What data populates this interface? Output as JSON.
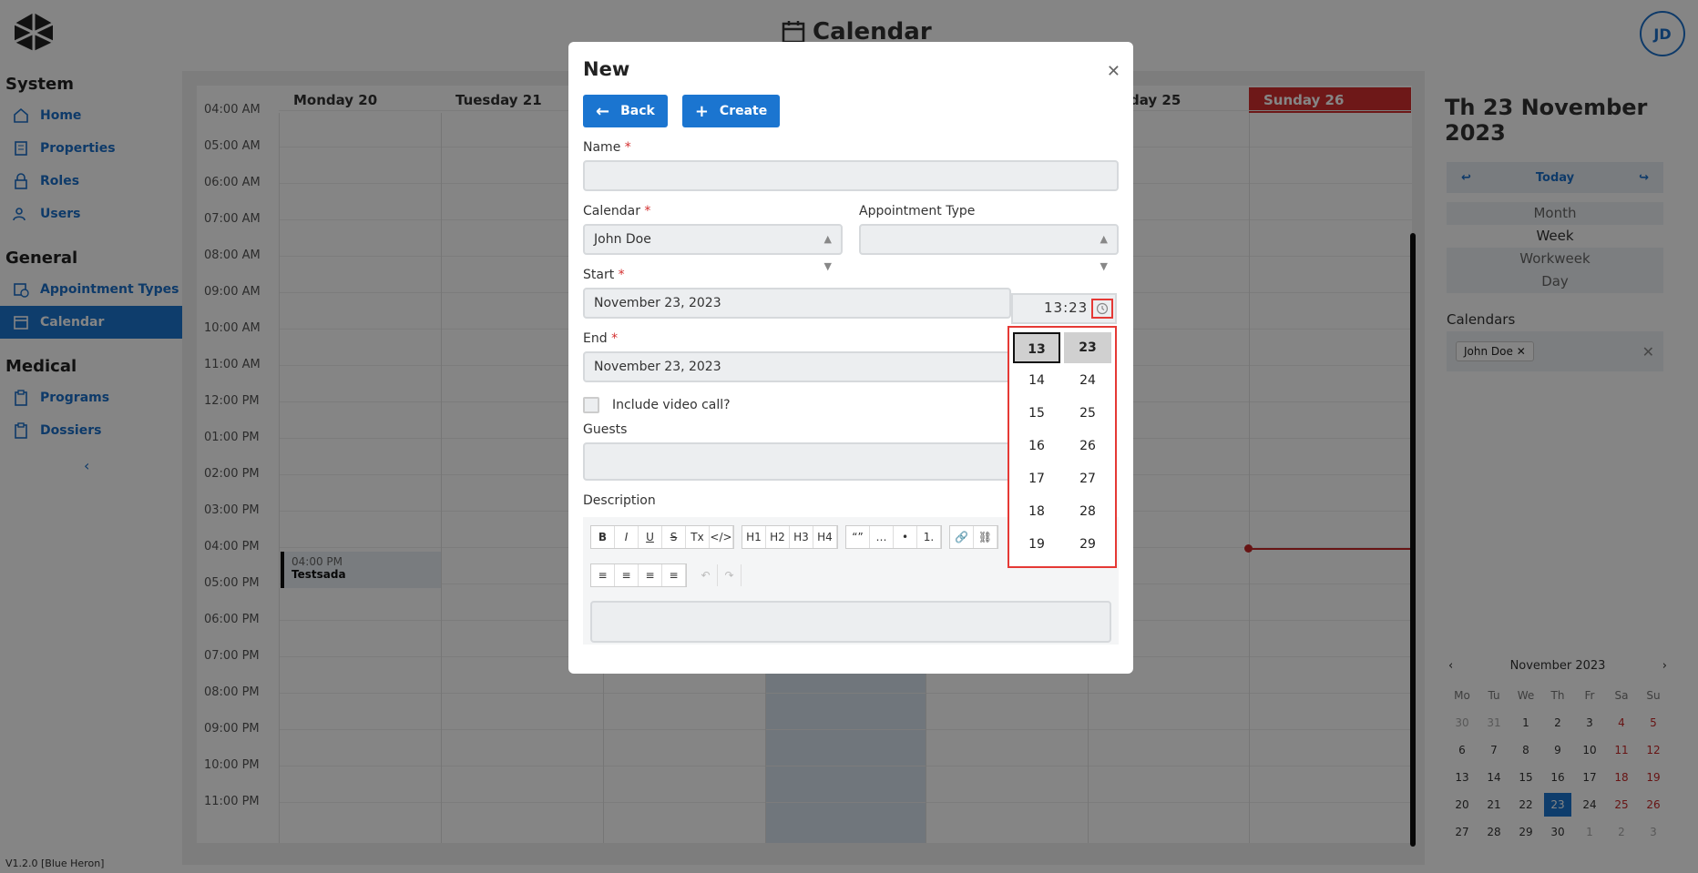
{
  "app": {
    "title": "Calendar",
    "avatar_initials": "JD",
    "version": "V1.2.0 [Blue Heron]"
  },
  "sidebar": {
    "sections": [
      {
        "title": "System",
        "items": [
          {
            "label": "Home",
            "icon": "home-icon"
          },
          {
            "label": "Properties",
            "icon": "building-icon"
          },
          {
            "label": "Roles",
            "icon": "lock-icon"
          },
          {
            "label": "Users",
            "icon": "users-icon"
          }
        ]
      },
      {
        "title": "General",
        "items": [
          {
            "label": "Appointment Types",
            "icon": "calendar-clock-icon"
          },
          {
            "label": "Calendar",
            "icon": "calendar-icon",
            "active": true
          }
        ]
      },
      {
        "title": "Medical",
        "items": [
          {
            "label": "Programs",
            "icon": "clipboard-icon"
          },
          {
            "label": "Dossiers",
            "icon": "clipboard-icon"
          }
        ]
      }
    ]
  },
  "calendar": {
    "days": [
      "Monday 20",
      "Tuesday 21",
      "day 25",
      "Sunday 26"
    ],
    "hours": [
      "04:00 AM",
      "05:00 AM",
      "06:00 AM",
      "07:00 AM",
      "08:00 AM",
      "09:00 AM",
      "10:00 AM",
      "11:00 AM",
      "12:00 PM",
      "01:00 PM",
      "02:00 PM",
      "03:00 PM",
      "04:00 PM",
      "05:00 PM",
      "06:00 PM",
      "07:00 PM",
      "08:00 PM",
      "09:00 PM",
      "10:00 PM",
      "11:00 PM"
    ],
    "event": {
      "time": "04:00 PM",
      "name": "Testsada"
    }
  },
  "right_panel": {
    "date": "Th 23 November 2023",
    "today_label": "Today",
    "views": [
      "Month",
      "Week",
      "Workweek",
      "Day"
    ],
    "selected_view": "Week",
    "calendars_label": "Calendars",
    "calendar_chip": "John Doe",
    "mini_month": "November 2023",
    "weekdays": [
      "Mo",
      "Tu",
      "We",
      "Th",
      "Fr",
      "Sa",
      "Su"
    ],
    "weeks": [
      [
        "30",
        "31",
        "1",
        "2",
        "3",
        "4",
        "5"
      ],
      [
        "6",
        "7",
        "8",
        "9",
        "10",
        "11",
        "12"
      ],
      [
        "13",
        "14",
        "15",
        "16",
        "17",
        "18",
        "19"
      ],
      [
        "20",
        "21",
        "22",
        "23",
        "24",
        "25",
        "26"
      ],
      [
        "27",
        "28",
        "29",
        "30",
        "1",
        "2",
        "3"
      ]
    ]
  },
  "modal": {
    "title": "New",
    "back_label": "Back",
    "create_label": "Create",
    "name_label": "Name",
    "name_value": "",
    "calendar_label": "Calendar",
    "calendar_value": "John Doe",
    "appt_type_label": "Appointment Type",
    "appt_type_value": "",
    "start_label": "Start",
    "start_date": "November 23, 2023",
    "start_time": "13:23",
    "end_label": "End",
    "end_date": "November 23, 2023",
    "video_label": "Include video call?",
    "guests_label": "Guests",
    "description_label": "Description",
    "toolbar_row1": [
      "B",
      "I",
      "U",
      "S",
      "Tx",
      "</>",
      "H1",
      "H2",
      "H3",
      "H4",
      "“”",
      "…",
      "•",
      "1.",
      "🔗",
      "⛓"
    ],
    "toolbar_row2": [
      "≡",
      "≡",
      "≡",
      "≡",
      "↶",
      "↷"
    ]
  },
  "time_picker": {
    "hours": [
      "13",
      "14",
      "15",
      "16",
      "17",
      "18",
      "19"
    ],
    "minutes": [
      "23",
      "24",
      "25",
      "26",
      "27",
      "28",
      "29"
    ],
    "selected_hour": "13",
    "selected_minute": "23"
  },
  "colors": {
    "accent": "#1b75d0",
    "danger": "#d32f2f",
    "highlight_border": "#e53935"
  }
}
